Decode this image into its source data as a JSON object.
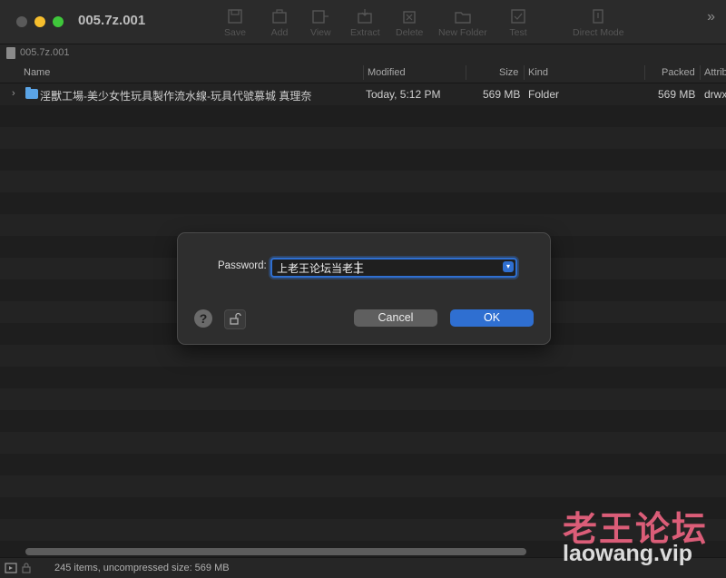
{
  "window": {
    "title": "005.7z.001"
  },
  "toolbar": {
    "items": [
      {
        "label": "Save",
        "icon": "save-icon"
      },
      {
        "label": "Add",
        "icon": "add-icon"
      },
      {
        "label": "View",
        "icon": "view-icon"
      },
      {
        "label": "Extract",
        "icon": "extract-icon"
      },
      {
        "label": "Delete",
        "icon": "delete-icon"
      },
      {
        "label": "New Folder",
        "icon": "new-folder-icon"
      },
      {
        "label": "Test",
        "icon": "test-icon"
      },
      {
        "label": "Direct Mode",
        "icon": "direct-mode-icon"
      }
    ],
    "overflow": "»"
  },
  "path": {
    "text": "005.7z.001"
  },
  "columns": {
    "name": "Name",
    "modified": "Modified",
    "size": "Size",
    "kind": "Kind",
    "packed": "Packed",
    "attributes": "Attrib"
  },
  "rows": [
    {
      "chevron": "›",
      "name": "淫獸工場-美少女性玩具製作流水線-玩具代號慕城 真理奈",
      "modified": "Today, 5:12 PM",
      "size": "569 MB",
      "kind": "Folder",
      "packed": "569 MB",
      "attributes": "drwx"
    }
  ],
  "dialog": {
    "password_label": "Password:",
    "password_value": "上老王论坛当老王",
    "help_label": "?",
    "cancel_label": "Cancel",
    "ok_label": "OK"
  },
  "status": {
    "text": "245 items, uncompressed size: 569 MB"
  },
  "watermark": {
    "cn": "老王论坛",
    "en": "laowang.vip"
  },
  "colors": {
    "accent": "#2f6fd1",
    "folder": "#5aa4e6",
    "watermark_cn": "#f06482"
  }
}
